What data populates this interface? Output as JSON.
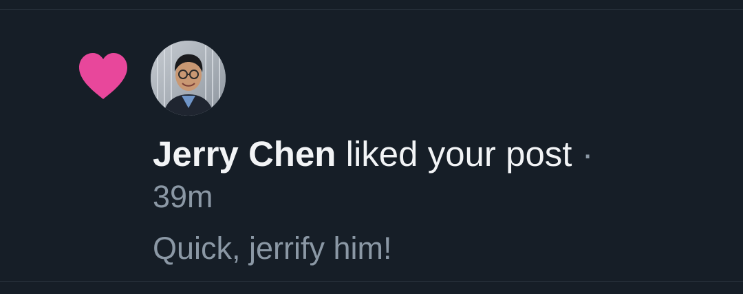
{
  "notification": {
    "type_icon": "heart-icon",
    "icon_color": "#e8479b",
    "avatar_icon": "user-avatar-photo",
    "actor_name": "Jerry Chen",
    "action_text": " liked your post ",
    "separator": "·",
    "timestamp": "39m",
    "post_snippet": "Quick, jerrify him!"
  },
  "colors": {
    "background": "#161e27",
    "primary_text": "#f2f4f6",
    "secondary_text": "#8b98a5",
    "divider": "#2a333e"
  }
}
